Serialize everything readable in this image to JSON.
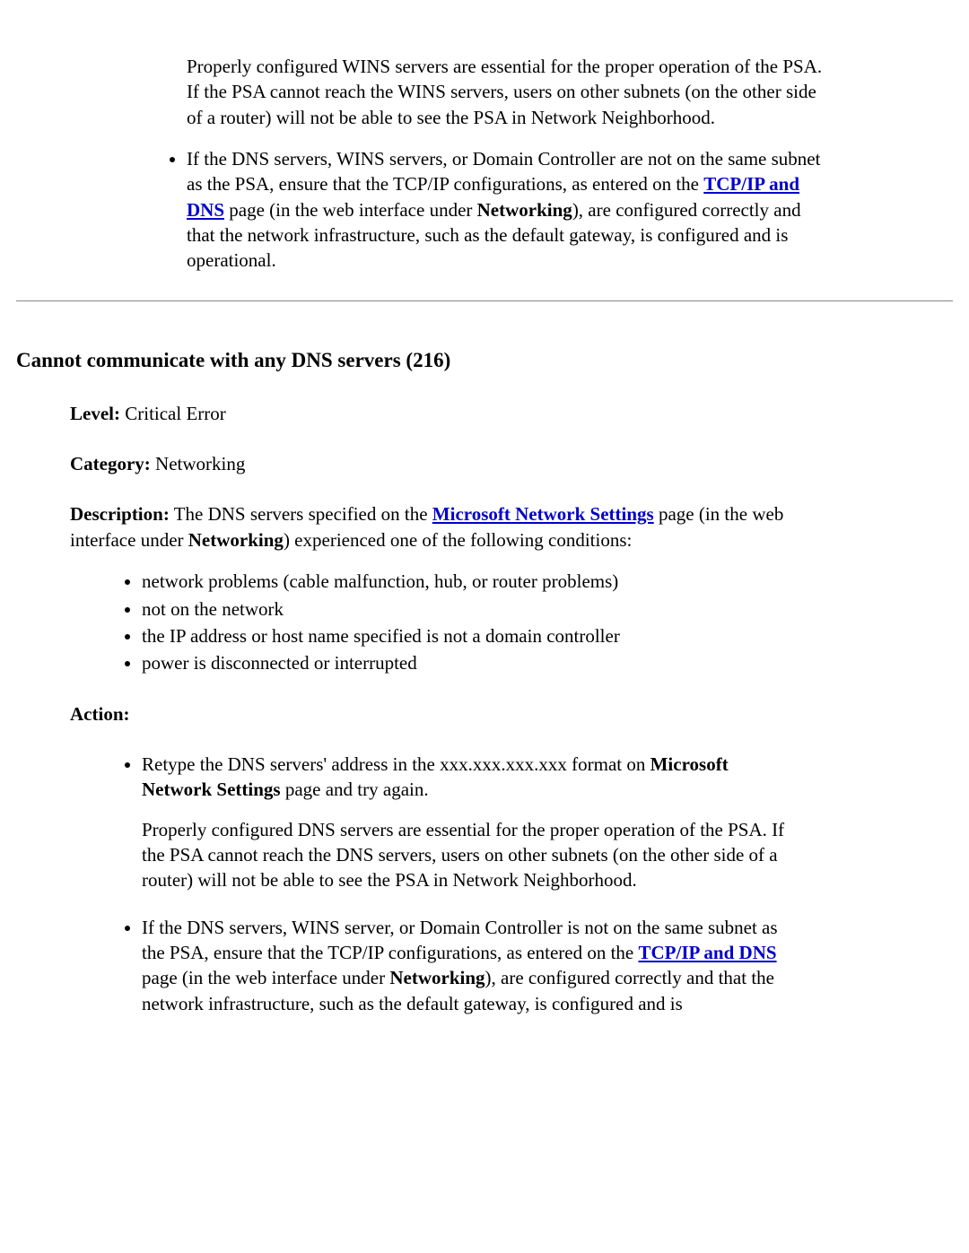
{
  "top": {
    "para1": "Properly configured WINS servers are essential for the proper operation of the PSA. If the PSA cannot reach the WINS servers, users on other subnets (on the other side of a router) will not be able to see the PSA in Network Neighborhood.",
    "bullet_pre": "If the DNS servers, WINS servers, or Domain Controller are not on the same subnet as the PSA, ensure that the TCP/IP configurations, as entered on the ",
    "link": "TCP/IP and DNS",
    "bullet_mid": " page (in the web interface under ",
    "networking": "Networking",
    "bullet_post": "), are configured correctly and that the network infrastructure, such as the default gateway, is configured and is operational."
  },
  "section": {
    "title": "Cannot communicate with any DNS servers (216)",
    "level_label": "Level:",
    "level_value": " Critical Error",
    "category_label": "Category:",
    "category_value": " Networking",
    "desc_label": "Description:",
    "desc_pre": " The DNS servers specified on the ",
    "desc_link": "Microsoft Network Settings",
    "desc_mid": " page (in the web interface under ",
    "desc_net": "Networking",
    "desc_post": ") experienced one of the following conditions:",
    "conditions": [
      "network problems (cable malfunction, hub, or router problems)",
      "not on the network",
      "the IP address or host name specified is not a domain controller",
      "power is disconnected or interrupted"
    ],
    "action_label": "Action:",
    "action1_pre": "Retype the DNS servers' address in the xxx.xxx.xxx.xxx format on ",
    "action1_bold": "Microsoft Network Settings",
    "action1_post": " page and try again.",
    "action1_para2": "Properly configured DNS servers are essential for the proper operation of the PSA. If the PSA cannot reach the DNS servers, users on other subnets (on the other side of a router) will not be able to see the PSA in Network Neighborhood.",
    "action2_pre": "If the DNS servers, WINS server, or Domain Controller is not on the same subnet as the PSA, ensure that the TCP/IP configurations, as entered on the ",
    "action2_link": "TCP/IP and DNS",
    "action2_mid": " page (in the web interface under ",
    "action2_net": "Networking",
    "action2_post": "), are configured correctly and that the network infrastructure, such as the default gateway, is configured and is"
  }
}
